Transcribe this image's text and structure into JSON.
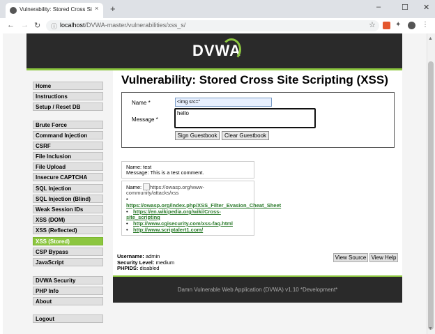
{
  "browser": {
    "tab_title": "Vulnerability: Stored Cross Site S",
    "tab_close": "×",
    "new_tab": "+",
    "url_host": "localhost",
    "url_path": "/DVWA-master/vulnerabilities/xss_s/",
    "win_minimize": "–",
    "win_maximize": "☐",
    "win_close": "✕"
  },
  "logo_text": "DVWA",
  "menu": [
    {
      "label": "Home"
    },
    {
      "label": "Instructions"
    },
    {
      "label": "Setup / Reset DB"
    },
    {
      "label": "Brute Force"
    },
    {
      "label": "Command Injection"
    },
    {
      "label": "CSRF"
    },
    {
      "label": "File Inclusion"
    },
    {
      "label": "File Upload"
    },
    {
      "label": "Insecure CAPTCHA"
    },
    {
      "label": "SQL Injection"
    },
    {
      "label": "SQL Injection (Blind)"
    },
    {
      "label": "Weak Session IDs"
    },
    {
      "label": "XSS (DOM)"
    },
    {
      "label": "XSS (Reflected)"
    },
    {
      "label": "XSS (Stored)"
    },
    {
      "label": "CSP Bypass"
    },
    {
      "label": "JavaScript"
    },
    {
      "label": "DVWA Security"
    },
    {
      "label": "PHP Info"
    },
    {
      "label": "About"
    },
    {
      "label": "Logout"
    }
  ],
  "page_title": "Vulnerability: Stored Cross Site Scripting (XSS)",
  "form": {
    "name_label": "Name *",
    "name_value": "<img src=\"",
    "message_label": "Message *",
    "message_value": "hello",
    "sign_button": "Sign Guestbook",
    "clear_button": "Clear Guestbook"
  },
  "entries": [
    {
      "name_line": "Name: test",
      "message_line": "Message: This is a test comment."
    },
    {
      "name_line": "Name:",
      "broken_img_alt_1": "https://owasp.org/www-",
      "broken_img_alt_2": "community/attacks/xss",
      "bullet": "•",
      "links": [
        "https://owasp.org/index.php/XSS_Filter_Evasion_Cheat_Sheet",
        "https://en.wikipedia.org/wiki/Cross-",
        "site_scripting",
        "http://www.cgisecurity.com/xss-faq.html",
        "http://www.scriptalert1.com/"
      ]
    }
  ],
  "status": {
    "username_label": "Username:",
    "username_value": "admin",
    "level_label": "Security Level:",
    "level_value": "medium",
    "phpids_label": "PHPIDS:",
    "phpids_value": "disabled"
  },
  "view_source": "View Source",
  "view_help": "View Help",
  "footer_text": "Damn Vulnerable Web Application (DVWA) v1.10 *Development*",
  "colors": {
    "accent": "#8cc63f",
    "header": "#2a2a2a",
    "link": "#2a7a2a"
  }
}
